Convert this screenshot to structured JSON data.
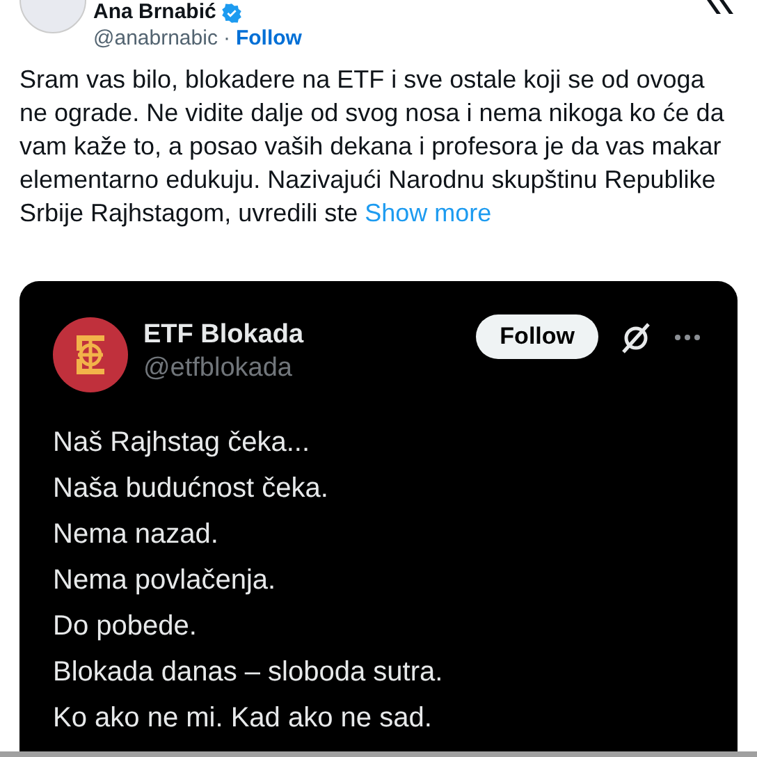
{
  "author": {
    "name": "Ana Brnabić",
    "handle": "@anabrnabic",
    "separator": "·",
    "follow": "Follow",
    "verified": true
  },
  "text": "Sram vas bilo, blokadere na ETF i sve ostale koji se od ovoga ne ograde. Ne vidite dalje od svog nosa i nema nikoga ko će da vam kaže to, a posao vaših dekana i profesora je da vas makar elementarno edukuju. Nazivajući Narodnu skupštinu Republike Srbije Rajhstagom, uvredili ste",
  "show_more": "Show more",
  "embedded": {
    "name": "ETF Blokada",
    "handle": "@etfblokada",
    "follow": "Follow",
    "lines": [
      "Naš Rajhstag čeka...",
      "Naša budućnost čeka.",
      "Nema nazad.",
      "Nema povlačenja.",
      "Do pobede.",
      "Blokada danas – sloboda sutra.",
      "Ko ako ne mi. Kad ako ne sad."
    ]
  }
}
